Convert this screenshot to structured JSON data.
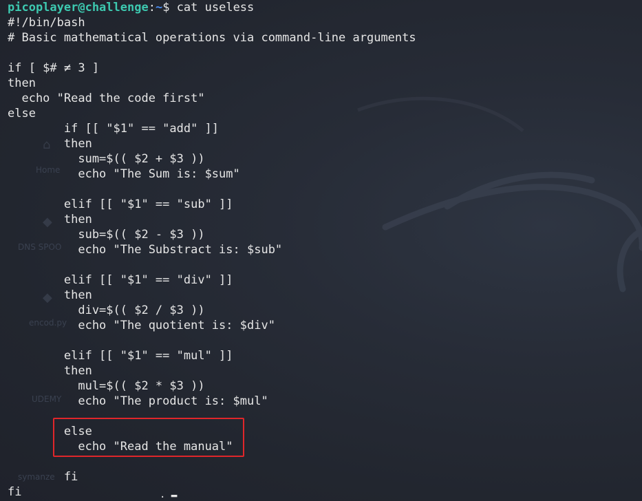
{
  "prompt": {
    "user_host": "picoplayer@challenge",
    "separator": ":",
    "path": "~",
    "sign": "$",
    "command": " cat useless"
  },
  "script_lines": [
    "#!/bin/bash",
    "# Basic mathematical operations via command-line arguments",
    "",
    "if [ $# ≠ 3 ]",
    "then",
    "  echo \"Read the code first\"",
    "else",
    "        if [[ \"$1\" == \"add\" ]]",
    "        then",
    "          sum=$(( $2 + $3 ))",
    "          echo \"The Sum is: $sum\"",
    "",
    "        elif [[ \"$1\" == \"sub\" ]]",
    "        then",
    "          sub=$(( $2 - $3 ))",
    "          echo \"The Substract is: $sub\"",
    "",
    "        elif [[ \"$1\" == \"div\" ]]",
    "        then",
    "          div=$(( $2 / $3 ))",
    "          echo \"The quotient is: $div\"",
    "",
    "        elif [[ \"$1\" == \"mul\" ]]",
    "        then",
    "          mul=$(( $2 * $3 ))",
    "          echo \"The product is: $mul\"",
    "",
    "        else",
    "          echo \"Read the manual\"",
    "",
    "        fi",
    "fi"
  ],
  "background_desktop": {
    "items": [
      "Home",
      "DNS SPOO",
      "encod.py",
      "UDEMY",
      "symanze"
    ]
  },
  "colors": {
    "user_host": "#3dc9b0",
    "path": "#4a8cf0",
    "text": "#e6e6e6",
    "highlight_border": "#e0262a",
    "background": "#23272f"
  },
  "icons": {
    "home": "home-icon",
    "python_file": "python-file-icon",
    "dragon": "kali-dragon-watermark-icon"
  }
}
